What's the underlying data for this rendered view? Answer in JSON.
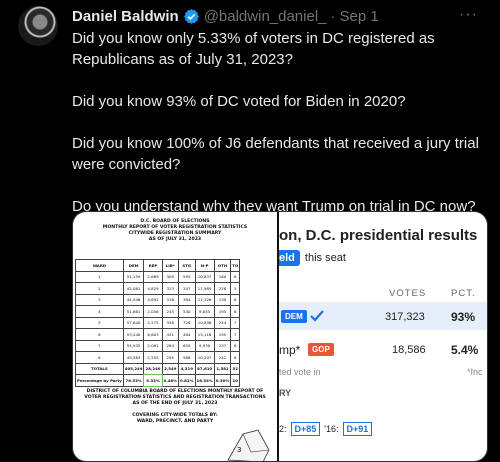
{
  "tweet": {
    "author_name": "Daniel Baldwin",
    "handle": "@baldwin_daniel_",
    "separator": "·",
    "date": "Sep 1",
    "more_label": "···",
    "paragraphs": [
      "Did you know only 5.33% of voters in DC registered as Republicans as of July 31, 2023?",
      "Did you know 93% of DC voted for Biden in 2020?",
      "Did you know 100% of J6 defendants that received a jury trial were convicted?",
      "Do you understand why they want Trump on trial in DC now?"
    ],
    "colors": {
      "verified": "#1d9bf0",
      "text": "#e7e9ea",
      "muted": "#71767b"
    }
  },
  "document": {
    "title_lines": [
      "D.C. BOARD OF ELECTIONS",
      "MONTHLY REPORT OF VOTER REGISTRATION STATISTICS",
      "CITYWIDE REGISTRATION SUMMARY",
      "AS OF JULY 31, 2023"
    ],
    "columns": [
      "WARD",
      "DEM",
      "REP",
      "LIB*",
      "STG",
      "N-P",
      "OTH",
      "TO"
    ],
    "rows": [
      [
        "1",
        "51,159",
        "2,669",
        "309",
        "595",
        "10,837",
        "160",
        "6"
      ],
      [
        "2",
        "42,081",
        "4,829",
        "323",
        "347",
        "11,985",
        "228",
        "5"
      ],
      [
        "3",
        "44,946",
        "4,892",
        "318",
        "384",
        "11,326",
        "130",
        "6"
      ],
      [
        "4",
        "51,661",
        "2,056",
        "243",
        "540",
        "9,055",
        "195",
        "6"
      ],
      [
        "5",
        "57,640",
        "2,575",
        "358",
        "726",
        "10,836",
        "244",
        "7"
      ],
      [
        "6",
        "53,240",
        "6,603",
        "421",
        "484",
        "13,116",
        "195",
        "7"
      ],
      [
        "7",
        "54,935",
        "2,061",
        "284",
        "655",
        "9,930",
        "237",
        "6"
      ],
      [
        "8",
        "49,583",
        "2,555",
        "295",
        "588",
        "10,207",
        "242",
        "6"
      ]
    ],
    "totals": [
      "TOTALS",
      "405,249",
      "28,240",
      "2,549",
      "4,319",
      "87,610",
      "1,581",
      "52"
    ],
    "percentages": [
      "Percentage by Party",
      "76.53%",
      "5.33%",
      "0.48%",
      "0.82%",
      "16.54%",
      "0.30%",
      "10"
    ],
    "footer_lines": [
      "DISTRICT OF COLUMBIA BOARD OF ELECTIONS MONTHLY REPORT OF",
      "VOTER REGISTRATION STATISTICS AND REGISTRATION TRANSACTIONS",
      "AS OF THE END OF JULY 31, 2023",
      "",
      "COVERING CITY-WIDE TOTALS BY:",
      "WARD, PRECINCT, AND PARTY"
    ],
    "map_number": "3"
  },
  "results": {
    "title": "on, D.C. presidential results",
    "held_label": "eld",
    "held_text": "this seat",
    "col_votes": "VOTES",
    "col_pct": "PCT.",
    "winner": {
      "party": "DEM",
      "votes": "317,323",
      "pct": "93%"
    },
    "loser": {
      "name": "mp*",
      "party": "GOP",
      "votes": "18,586",
      "pct": "5.4%"
    },
    "note": "ted vote in",
    "note_right": "*Inc",
    "section": "RY",
    "history": [
      "2:",
      "D+85",
      "'16:",
      "D+91"
    ],
    "colors": {
      "dem": "#1a73e8",
      "gop": "#e8553a",
      "win_bg": "#e6eef9"
    }
  }
}
